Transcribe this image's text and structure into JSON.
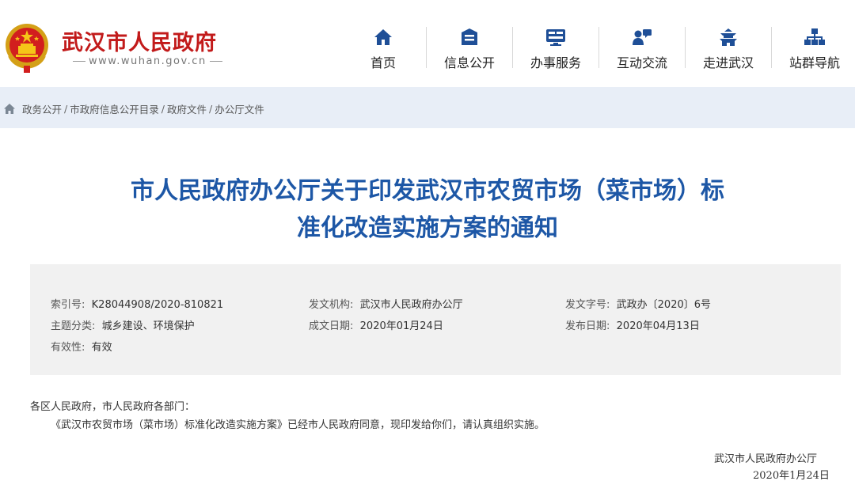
{
  "header": {
    "site_name": "武汉市人民政府",
    "site_url": "www.wuhan.gov.cn",
    "emblem_icon": "national-emblem-icon",
    "nav": [
      {
        "label": "首页",
        "icon": "home-icon"
      },
      {
        "label": "信息公开",
        "icon": "open-info-icon"
      },
      {
        "label": "办事服务",
        "icon": "service-screen-icon"
      },
      {
        "label": "互动交流",
        "icon": "interaction-icon"
      },
      {
        "label": "走进武汉",
        "icon": "landmark-icon"
      },
      {
        "label": "站群导航",
        "icon": "sitemap-icon"
      }
    ]
  },
  "breadcrumb": {
    "icon": "home-icon",
    "items": [
      "政务公开",
      "市政府信息公开目录",
      "政府文件",
      "办公厅文件"
    ],
    "separator": "/"
  },
  "document": {
    "title_line1": "市人民政府办公厅关于印发武汉市农贸市场（菜市场）标",
    "title_line2": "准化改造实施方案的通知",
    "meta": {
      "index_label": "索引号:",
      "index_value": "K28044908/2020-810821",
      "issuer_label": "发文机构:",
      "issuer_value": "武汉市人民政府办公厅",
      "doc_no_label": "发文字号:",
      "doc_no_value": "武政办〔2020〕6号",
      "category_label": "主题分类:",
      "category_value": "城乡建设、环境保护",
      "written_label": "成文日期:",
      "written_value": "2020年01月24日",
      "published_label": "发布日期:",
      "published_value": "2020年04月13日",
      "validity_label": "有效性:",
      "validity_value": "有效"
    },
    "salutation": "各区人民政府，市人民政府各部门：",
    "paragraph": "《武汉市农贸市场（菜市场）标准化改造实施方案》已经市人民政府同意，现印发给你们，请认真组织实施。",
    "signature": "武汉市人民政府办公厅",
    "date": "2020年1月24日"
  },
  "colors": {
    "brand_red": "#c21a1a",
    "title_blue": "#1d57a6",
    "nav_icon_blue": "#1f4f97",
    "breadcrumb_bg": "#e8eef7",
    "meta_bg": "#f1f1f1"
  }
}
